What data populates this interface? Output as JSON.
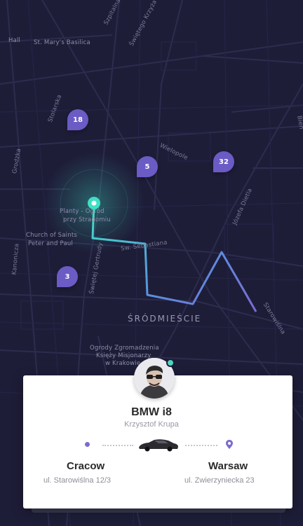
{
  "map": {
    "labels": {
      "hall": "Hall",
      "basilica": "St. Mary's Basilica",
      "szpitalna": "Szpitalna",
      "swietego_krzyza": "Świętego Krzyża",
      "stolarska": "Stolarska",
      "grodzka": "Grodzka",
      "wielopole": "Wielopole",
      "bien": "Bien",
      "planty_1": "Planty - Ogród",
      "planty_2": "przy Stradomiu",
      "church_1": "Church of Saints",
      "church_2": "Peter and Paul",
      "kanonicza": "Kanonicza",
      "swietej_gertrudy": "Świętej Gertrudy",
      "jozefa_dietla": "Józefa Dietla",
      "sw_sebastiana": "Sw. Sebastiana",
      "starowislna": "Starowiślna",
      "gardens_1": "Ogrody Zgromadzenia",
      "gardens_2": "Księży Misjonarzy",
      "gardens_3": "w Krakowie"
    },
    "district": "ŚRÓDMIEŚCIE",
    "pins": [
      {
        "count": "18"
      },
      {
        "count": "5"
      },
      {
        "count": "32"
      },
      {
        "count": "3"
      }
    ],
    "colors": {
      "background": "#1e1d38",
      "route_start": "#3ee0c4",
      "route_end": "#7b6bd1",
      "pin": "#6a5bc5"
    }
  },
  "trip": {
    "car": "BMW i8",
    "driver": "Krzysztof Krupa",
    "origin": {
      "city": "Cracow",
      "address": "ul. Starowiślna 12/3"
    },
    "destination": {
      "city": "Warsaw",
      "address": "ul. Zwierzyniecka 23"
    },
    "icons": {
      "origin": "origin-dot-icon",
      "destination": "location-pin-icon",
      "vehicle": "car-icon",
      "avatar": "driver-avatar"
    }
  }
}
